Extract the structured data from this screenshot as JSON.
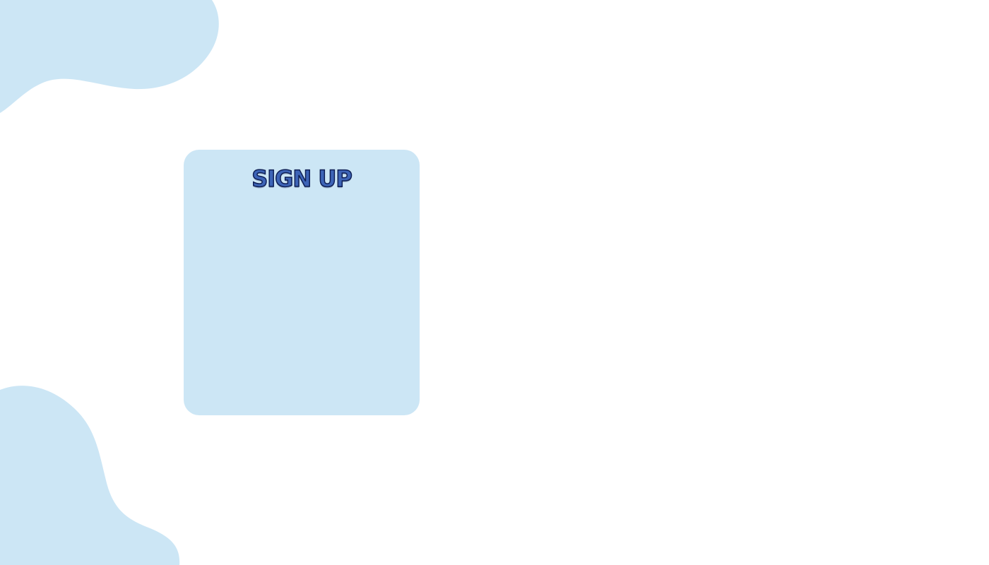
{
  "colors": {
    "background": "#ffffff",
    "blob": "#cce6f5",
    "card": "#cce6f5",
    "title": "#3d64b7",
    "title_stroke": "#0e1f55"
  },
  "signup": {
    "title": "SIGN UP"
  }
}
